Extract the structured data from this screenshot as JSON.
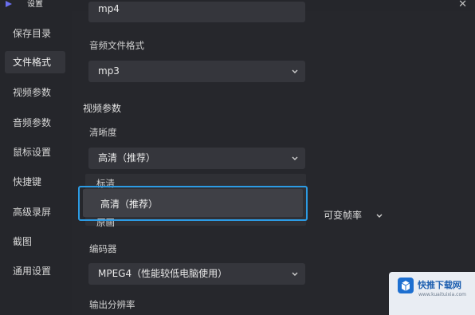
{
  "window": {
    "title": "设置",
    "close_glyph": "✕"
  },
  "sidebar": {
    "items": [
      {
        "label": "保存目录"
      },
      {
        "label": "文件格式",
        "active": true
      },
      {
        "label": "视频参数"
      },
      {
        "label": "音频参数"
      },
      {
        "label": "鼠标设置"
      },
      {
        "label": "快捷键"
      },
      {
        "label": "高级录屏"
      },
      {
        "label": "截图"
      },
      {
        "label": "通用设置"
      }
    ]
  },
  "file_format": {
    "video_format_value": "mp4",
    "audio_format_label": "音频文件格式",
    "audio_format_value": "mp3"
  },
  "video_params": {
    "section_title": "视频参数",
    "clarity_label": "清晰度",
    "clarity_value": "高清（推荐）",
    "clarity_options": [
      "标清",
      "高清（推荐）",
      "原画"
    ],
    "frame_rate_value": "可变帧率",
    "encoder_label": "编码器",
    "encoder_value": "MPEG4（性能较低电脑使用）",
    "resolution_label": "输出分辨率"
  },
  "watermark": {
    "name": "快推下载网",
    "url": "www.kuaituixia.com"
  },
  "colors": {
    "highlight": "#2c9be4",
    "background": "#25262b",
    "field": "#35363c"
  },
  "icons": {
    "chevron": "chevron-down-icon",
    "logo": "app-logo-icon"
  }
}
